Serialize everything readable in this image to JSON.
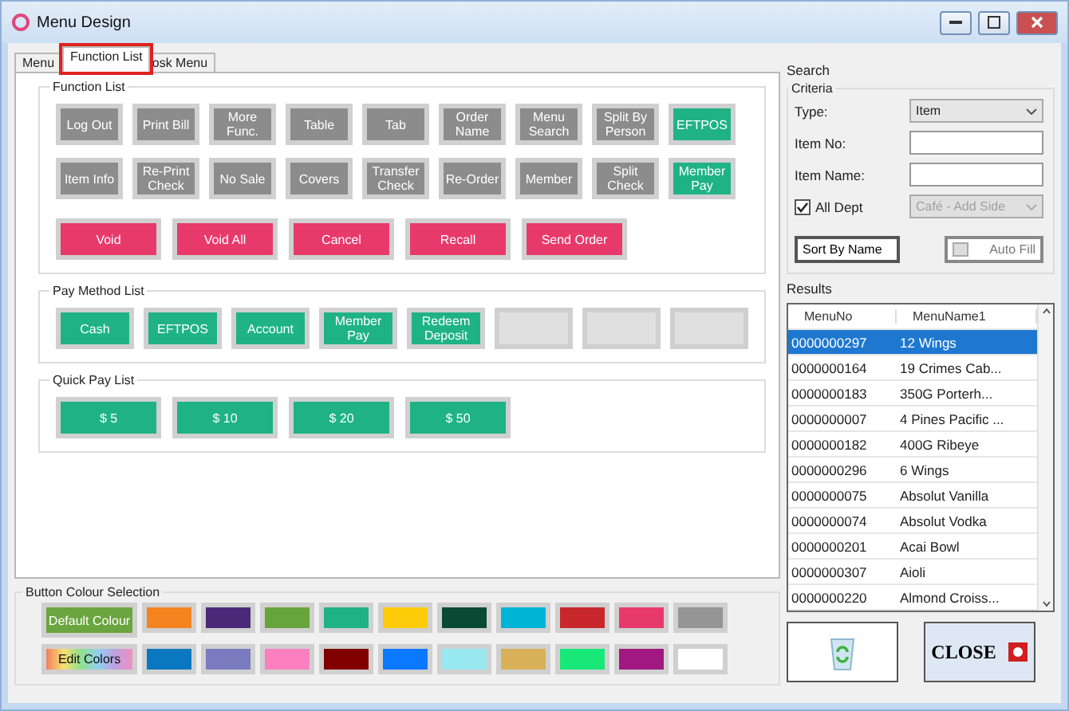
{
  "window": {
    "title": "Menu Design"
  },
  "tabs": [
    {
      "label": "Menu",
      "selected": false,
      "highlighted": false
    },
    {
      "label": "Function List",
      "selected": true,
      "highlighted": true
    },
    {
      "label": "osk Menu",
      "selected": false,
      "highlighted": false
    }
  ],
  "function_list": {
    "title": "Function List",
    "rows": [
      [
        {
          "label": "Log Out",
          "color": "#8c8c8c"
        },
        {
          "label": "Print Bill",
          "color": "#8c8c8c"
        },
        {
          "label": "More Func.",
          "color": "#8c8c8c"
        },
        {
          "label": "Table",
          "color": "#8c8c8c"
        },
        {
          "label": "Tab",
          "color": "#8c8c8c"
        },
        {
          "label": "Order Name",
          "color": "#8c8c8c"
        },
        {
          "label": "Menu Search",
          "color": "#8c8c8c"
        },
        {
          "label": "Split By Person",
          "color": "#8c8c8c"
        },
        {
          "label": "EFTPOS",
          "color": "#1fb384"
        }
      ],
      [
        {
          "label": "Item Info",
          "color": "#8c8c8c"
        },
        {
          "label": "Re-Print Check",
          "color": "#8c8c8c"
        },
        {
          "label": "No Sale",
          "color": "#8c8c8c"
        },
        {
          "label": "Covers",
          "color": "#8c8c8c"
        },
        {
          "label": "Transfer Check",
          "color": "#8c8c8c"
        },
        {
          "label": "Re-Order",
          "color": "#8c8c8c"
        },
        {
          "label": "Member",
          "color": "#8c8c8c"
        },
        {
          "label": "Split Check",
          "color": "#8c8c8c"
        },
        {
          "label": "Member Pay",
          "color": "#1fb384"
        }
      ]
    ],
    "actions": [
      {
        "label": "Void",
        "color": "#e83a6a"
      },
      {
        "label": "Void All",
        "color": "#e83a6a"
      },
      {
        "label": "Cancel",
        "color": "#e83a6a"
      },
      {
        "label": "Recall",
        "color": "#e83a6a"
      },
      {
        "label": "Send Order",
        "color": "#e83a6a"
      }
    ]
  },
  "pay_method_list": {
    "title": "Pay Method List",
    "items": [
      {
        "kind": "method",
        "label": "Cash"
      },
      {
        "kind": "method",
        "label": "EFTPOS"
      },
      {
        "kind": "method",
        "label": "Account"
      },
      {
        "kind": "method",
        "label": "Member Pay"
      },
      {
        "kind": "method",
        "label": "Redeem Deposit"
      },
      {
        "kind": "empty"
      },
      {
        "kind": "empty"
      },
      {
        "kind": "empty"
      }
    ]
  },
  "quick_pay_list": {
    "title": "Quick Pay List",
    "items": [
      "$ 5",
      "$ 10",
      "$ 20",
      "$ 50"
    ]
  },
  "colour_selection": {
    "title": "Button Colour Selection",
    "default_button": "Default Colour",
    "edit_button": "Edit Colors",
    "swatches": [
      [
        {
          "color": "#f38420"
        },
        {
          "color": "#4a2a78"
        },
        {
          "color": "#68a43c"
        },
        {
          "color": "#1fb384"
        },
        {
          "color": "#fdcb0a"
        },
        {
          "color": "#0a4a34"
        },
        {
          "color": "#00b4d8"
        },
        {
          "color": "#c8282c"
        },
        {
          "color": "#e83a6a"
        },
        {
          "color": "#959595"
        }
      ],
      [
        {
          "color": "#0a78c0"
        },
        {
          "color": "#7b7bc0"
        },
        {
          "color": "#fc80c0"
        },
        {
          "color": "#800000"
        },
        {
          "color": "#0a78ff"
        },
        {
          "color": "#98e8f0"
        },
        {
          "color": "#d8b058"
        },
        {
          "color": "#18e878"
        },
        {
          "color": "#a01880"
        },
        {
          "color": "#ffffff"
        }
      ]
    ]
  },
  "search": {
    "title": "Search",
    "criteria_title": "Criteria",
    "type_label": "Type:",
    "type_value": "Item",
    "item_no_label": "Item No:",
    "item_name_label": "Item Name:",
    "all_dept": {
      "label": "All Dept",
      "checked": true
    },
    "dept_value": "Café - Add Side",
    "sort_button": "Sort By Name",
    "auto_fill_button": "Auto Fill"
  },
  "results": {
    "title": "Results",
    "columns": [
      "MenuNo",
      "MenuName1"
    ],
    "rows": [
      {
        "no": "0000000297",
        "name": "12 Wings",
        "selected": true
      },
      {
        "no": "0000000164",
        "name": "19 Crimes Cab...",
        "selected": false
      },
      {
        "no": "0000000183",
        "name": "350G Porterh...",
        "selected": false
      },
      {
        "no": "0000000007",
        "name": "4 Pines Pacific ...",
        "selected": false
      },
      {
        "no": "0000000182",
        "name": "400G Ribeye",
        "selected": false
      },
      {
        "no": "0000000296",
        "name": "6 Wings",
        "selected": false
      },
      {
        "no": "0000000075",
        "name": "Absolut Vanilla",
        "selected": false
      },
      {
        "no": "0000000074",
        "name": "Absolut Vodka",
        "selected": false
      },
      {
        "no": "0000000201",
        "name": "Acai Bowl",
        "selected": false
      },
      {
        "no": "0000000307",
        "name": "Aioli",
        "selected": false
      },
      {
        "no": "0000000220",
        "name": "Almond Croiss...",
        "selected": false
      }
    ]
  },
  "close_button": "CLOSE"
}
